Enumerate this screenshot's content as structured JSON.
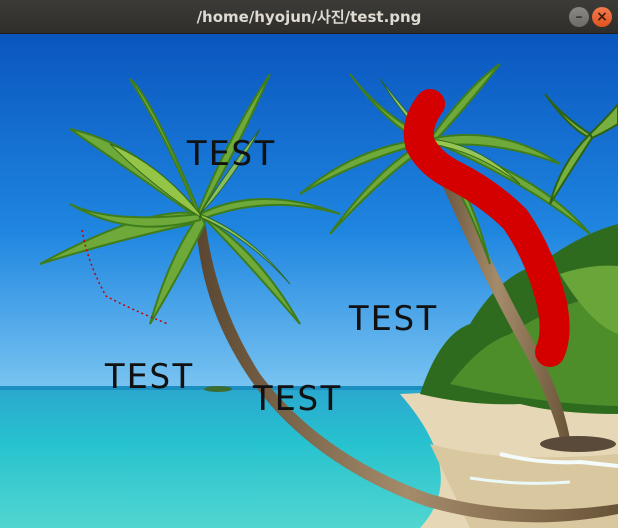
{
  "window": {
    "title": "/home/hyojun/사진/test.png",
    "minimize_glyph": "–",
    "close_glyph": "×"
  },
  "image": {
    "labels": [
      "TEST",
      "TEST",
      "TEST",
      "TEST"
    ],
    "stroke_color": "#d40000",
    "sky_top": "#0b5fc4",
    "sea_color": "#22b7c9",
    "sand_color": "#e9dcc0"
  }
}
